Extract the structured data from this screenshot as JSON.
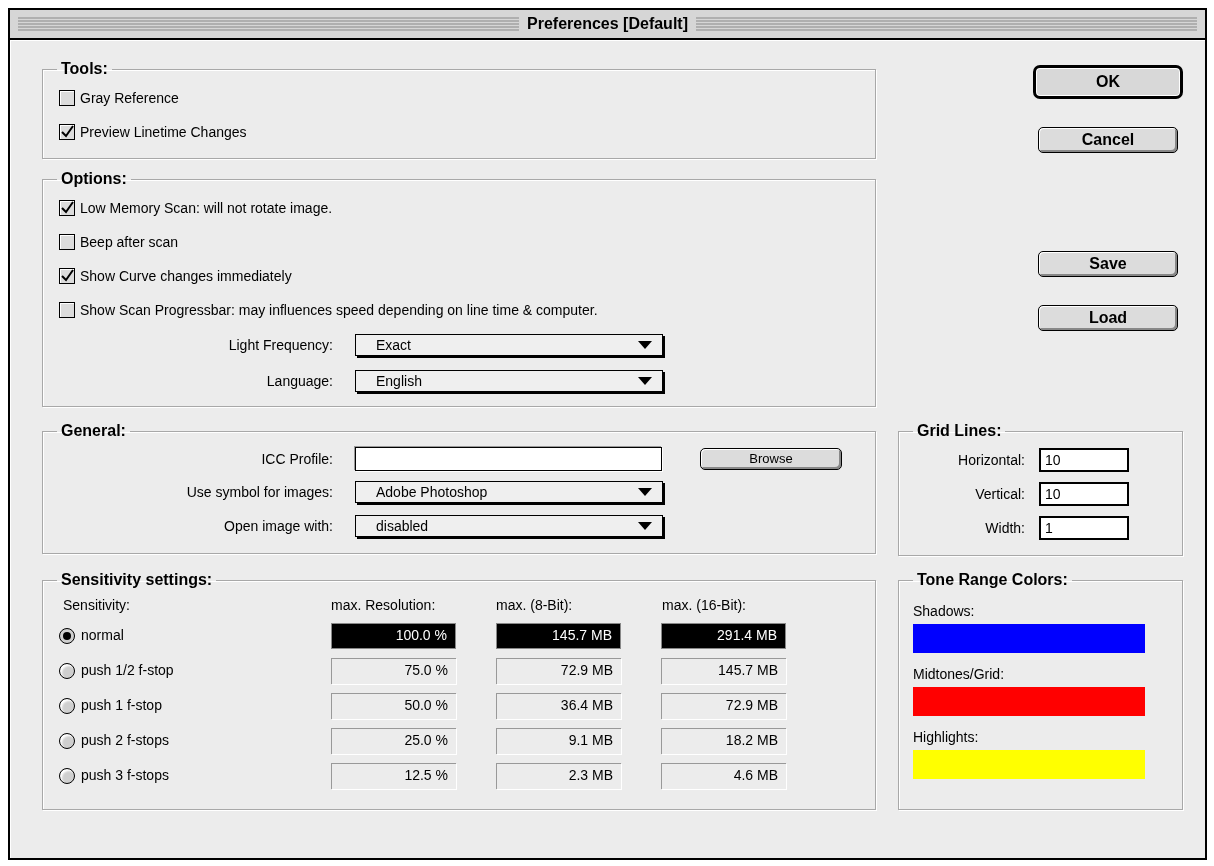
{
  "window": {
    "title": "Preferences [Default]"
  },
  "tools": {
    "title": "Tools:",
    "checkboxes": [
      {
        "label": "Gray Reference",
        "checked": false
      },
      {
        "label": "Preview Linetime Changes",
        "checked": true
      }
    ]
  },
  "options": {
    "title": "Options:",
    "checkboxes": [
      {
        "label": "Low Memory Scan: will not rotate image.",
        "checked": true
      },
      {
        "label": "Beep after scan",
        "checked": false
      },
      {
        "label": "Show Curve changes immediately",
        "checked": true
      },
      {
        "label": "Show Scan Progressbar: may influences speed depending on line time & computer.",
        "checked": false
      }
    ],
    "dropdowns": [
      {
        "label": "Light Frequency:",
        "value": "Exact"
      },
      {
        "label": "Language:",
        "value": "English"
      }
    ]
  },
  "buttons": [
    {
      "label": "OK",
      "default": true
    },
    {
      "label": "Cancel",
      "default": false
    },
    {
      "label": "Save",
      "default": false
    },
    {
      "label": "Load",
      "default": false
    }
  ],
  "general": {
    "title": "General:",
    "icc_profile": {
      "label": "ICC Profile:",
      "button": "Browse"
    },
    "dropdowns": [
      {
        "label": "Use symbol for images:",
        "value": "Adobe Photoshop"
      },
      {
        "label": "Open image with:",
        "value": "disabled"
      }
    ]
  },
  "grid_lines": {
    "title": "Grid Lines:",
    "fields": [
      {
        "label": "Horizontal:",
        "value": "10"
      },
      {
        "label": "Vertical:",
        "value": "10"
      },
      {
        "label": "Width:",
        "value": "1"
      }
    ]
  },
  "sensitivity": {
    "title": "Sensitivity settings:",
    "columns": [
      "Sensitivity:",
      "max. Resolution:",
      "max. (8-Bit):",
      "max. (16-Bit):"
    ],
    "rows": [
      {
        "label": "normal",
        "selected": true,
        "resolution": "100.0 %",
        "size_8bit": "145.7 MB",
        "size_16bit": "291.4 MB"
      },
      {
        "label": "push 1/2 f-stop",
        "selected": false,
        "resolution": "75.0 %",
        "size_8bit": "72.9 MB",
        "size_16bit": "145.7 MB"
      },
      {
        "label": "push 1 f-stop",
        "selected": false,
        "resolution": "50.0 %",
        "size_8bit": "36.4 MB",
        "size_16bit": "72.9 MB"
      },
      {
        "label": "push 2 f-stops",
        "selected": false,
        "resolution": "25.0 %",
        "size_8bit": "9.1 MB",
        "size_16bit": "18.2 MB"
      },
      {
        "label": "push 3 f-stops",
        "selected": false,
        "resolution": "12.5 %",
        "size_8bit": "2.3 MB",
        "size_16bit": "4.6 MB"
      }
    ]
  },
  "tone_range_colors": {
    "title": "Tone Range Colors:",
    "items": [
      {
        "label": "Shadows:",
        "color": "#0000ff"
      },
      {
        "label": "Midtones/Grid:",
        "color": "#ff0000"
      },
      {
        "label": "Highlights:",
        "color": "#ffff00"
      }
    ]
  }
}
